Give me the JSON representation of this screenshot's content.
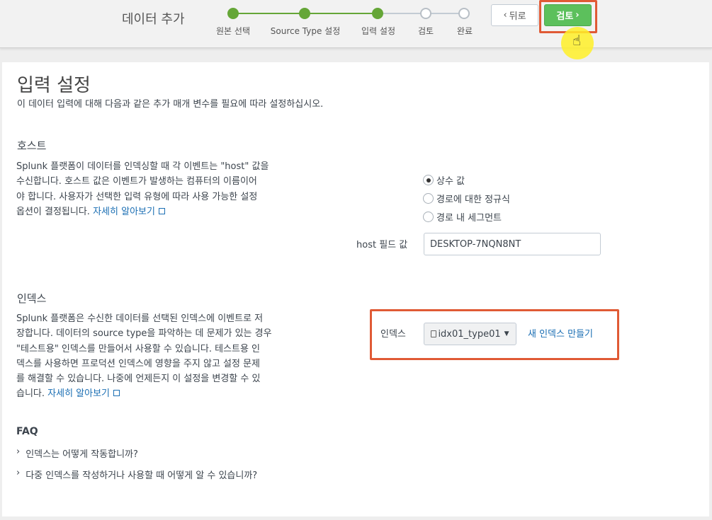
{
  "header": {
    "title": "데이터 추가",
    "steps": [
      {
        "label": "원본 선택",
        "state": "done"
      },
      {
        "label": "Source Type 설정",
        "state": "done"
      },
      {
        "label": "입력 설정",
        "state": "done"
      },
      {
        "label": "검토",
        "state": "todo"
      },
      {
        "label": "완료",
        "state": "todo"
      }
    ],
    "back_label": "뒤로",
    "review_label": "검토",
    "back_icon": "chevron-left-icon",
    "review_icon": "chevron-right-icon"
  },
  "colors": {
    "step_done": "#65a637",
    "primary_button": "#5cc05c",
    "highlight_frame": "#e05a35",
    "link": "#1a6eb3"
  },
  "main": {
    "title": "입력 설정",
    "subtitle": "이 데이터 입력에 대해 다음과 같은 추가 매개 변수를 필요에 따라 설정하십시오.",
    "host": {
      "heading": "호스트",
      "desc_lines": [
        "Splunk 플랫폼이 데이터를 인덱싱할 때 각 이벤트는 \"host\" 값을",
        "수신합니다. 호스트 값은 이벤트가 발생하는 컴퓨터의 이름이어",
        "야 합니다. 사용자가 선택한 입력 유형에 따라 사용 가능한 설정",
        "옵션이 결정됩니다."
      ],
      "learn_more": "자세히 알아보기",
      "options": [
        "상수 값",
        "경로에 대한 정규식",
        "경로 내 세그먼트"
      ],
      "selected_option": "상수 값",
      "field_label": "host 필드 값",
      "field_value": "DESKTOP-7NQN8NT"
    },
    "index": {
      "heading": "인덱스",
      "desc_lines": [
        "Splunk 플랫폼은 수신한 데이터를 선택된 인덱스에 이벤트로 저",
        "장합니다. 데이터의 source type을 파악하는 데 문제가 있는 경우",
        "\"테스트용\" 인덱스를 만들어서 사용할 수 있습니다. 테스트용 인",
        "덱스를 사용하면 프로덕션 인덱스에 영향을 주지 않고 설정 문제",
        "를 해결할 수 있습니다. 나중에 언제든지 이 설정을 변경할 수 있",
        "습니다."
      ],
      "learn_more": "자세히 알아보기",
      "field_label": "인덱스",
      "selected_index": "idx01_type01",
      "new_index_link": "새 인덱스 만들기"
    },
    "faq": {
      "heading": "FAQ",
      "items": [
        "인덱스는 어떻게 작동합니까?",
        "다중 인덱스를 작성하거나 사용할 때 어떻게 알 수 있습니까?"
      ]
    }
  }
}
